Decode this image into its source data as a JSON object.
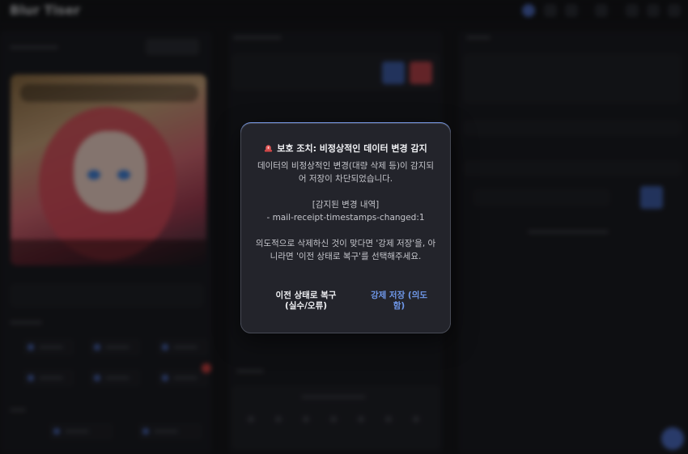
{
  "app": {
    "title": "Blur Tiser"
  },
  "modal": {
    "title": "보호 조치: 비정상적인 데이터 변경 감지",
    "message_line1": "데이터의 비정상적인 변경(대량 삭제 등)이 감지되",
    "message_line2": "어 저장이 차단되었습니다.",
    "changes_header": "[감지된 변경 내역]",
    "change_item": "- mail-receipt-timestamps-changed:1",
    "prompt_line1": "의도적으로 삭제하신 것이 맞다면 '강제 저장'을, 아",
    "prompt_line2": "니라면 '이전 상태로 복구'를 선택해주세요.",
    "restore_button": "이전 상태로 복구 (실수/오류)",
    "force_save_button": "강제 저장 (의도함)"
  },
  "colors": {
    "accent": "#6f98ea",
    "danger": "#c94040",
    "modal_bg": "#23242b"
  }
}
